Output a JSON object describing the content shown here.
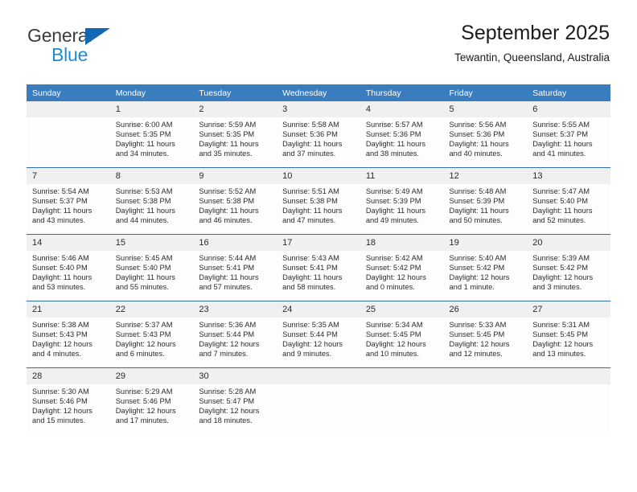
{
  "brand": {
    "name_line1": "General",
    "name_line2": "Blue",
    "colors": {
      "text_dark": "#3c3c3c",
      "blue_triangle": "#1268b3",
      "blue_text": "#1e8bd7"
    }
  },
  "header": {
    "title": "September 2025",
    "subtitle": "Tewantin, Queensland, Australia"
  },
  "calendar": {
    "accent_header_bg": "#3a7dbf",
    "row_divider_color": "#2f6ead",
    "daynum_bg": "#f0f0f0",
    "weekdays": [
      "Sunday",
      "Monday",
      "Tuesday",
      "Wednesday",
      "Thursday",
      "Friday",
      "Saturday"
    ],
    "weeks": [
      [
        {
          "day": "",
          "empty": true,
          "sunrise": "",
          "sunset": "",
          "daylight": ""
        },
        {
          "day": "1",
          "sunrise": "Sunrise: 6:00 AM",
          "sunset": "Sunset: 5:35 PM",
          "daylight": "Daylight: 11 hours and 34 minutes."
        },
        {
          "day": "2",
          "sunrise": "Sunrise: 5:59 AM",
          "sunset": "Sunset: 5:35 PM",
          "daylight": "Daylight: 11 hours and 35 minutes."
        },
        {
          "day": "3",
          "sunrise": "Sunrise: 5:58 AM",
          "sunset": "Sunset: 5:36 PM",
          "daylight": "Daylight: 11 hours and 37 minutes."
        },
        {
          "day": "4",
          "sunrise": "Sunrise: 5:57 AM",
          "sunset": "Sunset: 5:36 PM",
          "daylight": "Daylight: 11 hours and 38 minutes."
        },
        {
          "day": "5",
          "sunrise": "Sunrise: 5:56 AM",
          "sunset": "Sunset: 5:36 PM",
          "daylight": "Daylight: 11 hours and 40 minutes."
        },
        {
          "day": "6",
          "sunrise": "Sunrise: 5:55 AM",
          "sunset": "Sunset: 5:37 PM",
          "daylight": "Daylight: 11 hours and 41 minutes."
        }
      ],
      [
        {
          "day": "7",
          "sunrise": "Sunrise: 5:54 AM",
          "sunset": "Sunset: 5:37 PM",
          "daylight": "Daylight: 11 hours and 43 minutes."
        },
        {
          "day": "8",
          "sunrise": "Sunrise: 5:53 AM",
          "sunset": "Sunset: 5:38 PM",
          "daylight": "Daylight: 11 hours and 44 minutes."
        },
        {
          "day": "9",
          "sunrise": "Sunrise: 5:52 AM",
          "sunset": "Sunset: 5:38 PM",
          "daylight": "Daylight: 11 hours and 46 minutes."
        },
        {
          "day": "10",
          "sunrise": "Sunrise: 5:51 AM",
          "sunset": "Sunset: 5:38 PM",
          "daylight": "Daylight: 11 hours and 47 minutes."
        },
        {
          "day": "11",
          "sunrise": "Sunrise: 5:49 AM",
          "sunset": "Sunset: 5:39 PM",
          "daylight": "Daylight: 11 hours and 49 minutes."
        },
        {
          "day": "12",
          "sunrise": "Sunrise: 5:48 AM",
          "sunset": "Sunset: 5:39 PM",
          "daylight": "Daylight: 11 hours and 50 minutes."
        },
        {
          "day": "13",
          "sunrise": "Sunrise: 5:47 AM",
          "sunset": "Sunset: 5:40 PM",
          "daylight": "Daylight: 11 hours and 52 minutes."
        }
      ],
      [
        {
          "day": "14",
          "sunrise": "Sunrise: 5:46 AM",
          "sunset": "Sunset: 5:40 PM",
          "daylight": "Daylight: 11 hours and 53 minutes."
        },
        {
          "day": "15",
          "sunrise": "Sunrise: 5:45 AM",
          "sunset": "Sunset: 5:40 PM",
          "daylight": "Daylight: 11 hours and 55 minutes."
        },
        {
          "day": "16",
          "sunrise": "Sunrise: 5:44 AM",
          "sunset": "Sunset: 5:41 PM",
          "daylight": "Daylight: 11 hours and 57 minutes."
        },
        {
          "day": "17",
          "sunrise": "Sunrise: 5:43 AM",
          "sunset": "Sunset: 5:41 PM",
          "daylight": "Daylight: 11 hours and 58 minutes."
        },
        {
          "day": "18",
          "sunrise": "Sunrise: 5:42 AM",
          "sunset": "Sunset: 5:42 PM",
          "daylight": "Daylight: 12 hours and 0 minutes."
        },
        {
          "day": "19",
          "sunrise": "Sunrise: 5:40 AM",
          "sunset": "Sunset: 5:42 PM",
          "daylight": "Daylight: 12 hours and 1 minute."
        },
        {
          "day": "20",
          "sunrise": "Sunrise: 5:39 AM",
          "sunset": "Sunset: 5:42 PM",
          "daylight": "Daylight: 12 hours and 3 minutes."
        }
      ],
      [
        {
          "day": "21",
          "sunrise": "Sunrise: 5:38 AM",
          "sunset": "Sunset: 5:43 PM",
          "daylight": "Daylight: 12 hours and 4 minutes."
        },
        {
          "day": "22",
          "sunrise": "Sunrise: 5:37 AM",
          "sunset": "Sunset: 5:43 PM",
          "daylight": "Daylight: 12 hours and 6 minutes."
        },
        {
          "day": "23",
          "sunrise": "Sunrise: 5:36 AM",
          "sunset": "Sunset: 5:44 PM",
          "daylight": "Daylight: 12 hours and 7 minutes."
        },
        {
          "day": "24",
          "sunrise": "Sunrise: 5:35 AM",
          "sunset": "Sunset: 5:44 PM",
          "daylight": "Daylight: 12 hours and 9 minutes."
        },
        {
          "day": "25",
          "sunrise": "Sunrise: 5:34 AM",
          "sunset": "Sunset: 5:45 PM",
          "daylight": "Daylight: 12 hours and 10 minutes."
        },
        {
          "day": "26",
          "sunrise": "Sunrise: 5:33 AM",
          "sunset": "Sunset: 5:45 PM",
          "daylight": "Daylight: 12 hours and 12 minutes."
        },
        {
          "day": "27",
          "sunrise": "Sunrise: 5:31 AM",
          "sunset": "Sunset: 5:45 PM",
          "daylight": "Daylight: 12 hours and 13 minutes."
        }
      ],
      [
        {
          "day": "28",
          "sunrise": "Sunrise: 5:30 AM",
          "sunset": "Sunset: 5:46 PM",
          "daylight": "Daylight: 12 hours and 15 minutes."
        },
        {
          "day": "29",
          "sunrise": "Sunrise: 5:29 AM",
          "sunset": "Sunset: 5:46 PM",
          "daylight": "Daylight: 12 hours and 17 minutes."
        },
        {
          "day": "30",
          "sunrise": "Sunrise: 5:28 AM",
          "sunset": "Sunset: 5:47 PM",
          "daylight": "Daylight: 12 hours and 18 minutes."
        },
        {
          "day": "",
          "empty": true,
          "sunrise": "",
          "sunset": "",
          "daylight": ""
        },
        {
          "day": "",
          "empty": true,
          "sunrise": "",
          "sunset": "",
          "daylight": ""
        },
        {
          "day": "",
          "empty": true,
          "sunrise": "",
          "sunset": "",
          "daylight": ""
        },
        {
          "day": "",
          "empty": true,
          "sunrise": "",
          "sunset": "",
          "daylight": ""
        }
      ]
    ]
  }
}
